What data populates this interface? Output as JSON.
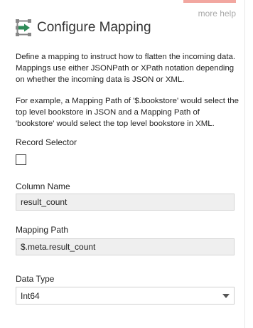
{
  "header": {
    "title": "Configure Mapping",
    "help_link": "more help",
    "icon": "mapping-arrow-icon"
  },
  "description": {
    "p1": "Define a mapping to instruct how to flatten the incoming data. Mappings use either JSONPath or XPath notation depending on whether the incoming data is JSON or XML.",
    "p2": "For example, a Mapping Path of '$.bookstore' would select the top level bookstore in JSON and a Mapping Path of 'bookstore' would select the top level bookstore in XML."
  },
  "record_selector": {
    "label": "Record Selector",
    "checked": false
  },
  "column_name": {
    "label": "Column Name",
    "value": "result_count"
  },
  "mapping_path": {
    "label": "Mapping Path",
    "value": "$.meta.result_count"
  },
  "data_type": {
    "label": "Data Type",
    "value": "Int64"
  },
  "colors": {
    "accent_green": "#2e8b57",
    "help_border": "#f2a7a0",
    "field_bg": "#efefef"
  }
}
